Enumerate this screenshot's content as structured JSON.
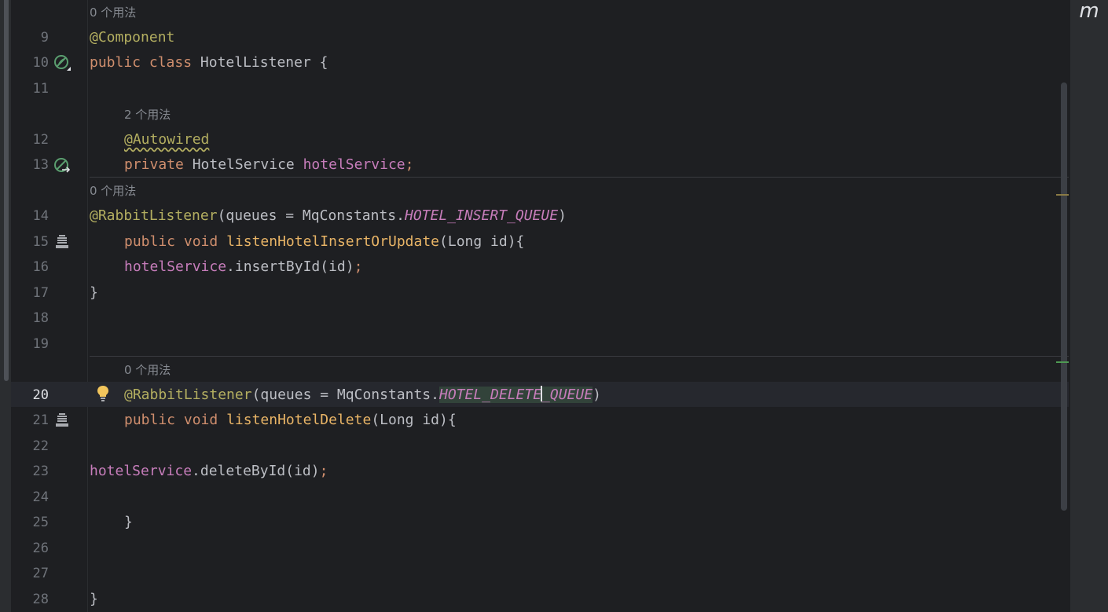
{
  "usage_hints": {
    "class": "0 个用法",
    "field": "2 个用法",
    "insert_method": "0 个用法",
    "delete_method": "0 个用法"
  },
  "line_numbers": [
    "9",
    "10",
    "11",
    "12",
    "13",
    "14",
    "15",
    "16",
    "17",
    "18",
    "19",
    "20",
    "21",
    "22",
    "23",
    "24",
    "25",
    "26",
    "27",
    "28"
  ],
  "code": {
    "l9": {
      "annotation": "@Component"
    },
    "l10": {
      "kw1": "public",
      "kw2": "class",
      "name": "HotelListener",
      "brace": "{"
    },
    "l12": {
      "annotation": "@Autowired"
    },
    "l13": {
      "kw": "private",
      "type": "HotelService",
      "field": "hotelService",
      "semi": ";"
    },
    "l14": {
      "annotation": "@RabbitListener",
      "args": "(queues = MqConstants.",
      "const": "HOTEL_INSERT_QUEUE",
      "close": ")"
    },
    "l15": {
      "kw1": "public",
      "kw2": "void",
      "method": "listenHotelInsertOrUpdate",
      "params": "(Long id){"
    },
    "l16": {
      "field": "hotelService",
      "call": ".insertById(id)",
      "semi": ";"
    },
    "l17": {
      "brace": "}"
    },
    "l20": {
      "annotation": "@RabbitListener",
      "args": "(queues = MqConstants.",
      "const_a": "HOTEL_DELETE",
      "const_b": "_QUEUE",
      "close": ")"
    },
    "l21": {
      "kw1": "public",
      "kw2": "void",
      "method": "listenHotelDelete",
      "params": "(Long id){"
    },
    "l23": {
      "field": "hotelService",
      "call": ".deleteById(id)",
      "semi": ";"
    },
    "l25": {
      "brace": "}"
    },
    "l28": {
      "brace": "}"
    }
  },
  "right_panel": {
    "label": "m"
  },
  "icons": {
    "line10": "bean-class-gutter-icon",
    "line13": "injection-point-gutter-icon",
    "line15": "listener-method-gutter-icon",
    "line21": "listener-method-gutter-icon",
    "line20": "intention-bulb-icon"
  },
  "colors": {
    "background": "#1e1f22",
    "keyword": "#cf8e6d",
    "annotation": "#b3ae60",
    "field": "#c77dbb",
    "declaration": "#e8b466",
    "text": "#bcbec4",
    "hint": "#868a91",
    "line_number": "#6f737a"
  }
}
